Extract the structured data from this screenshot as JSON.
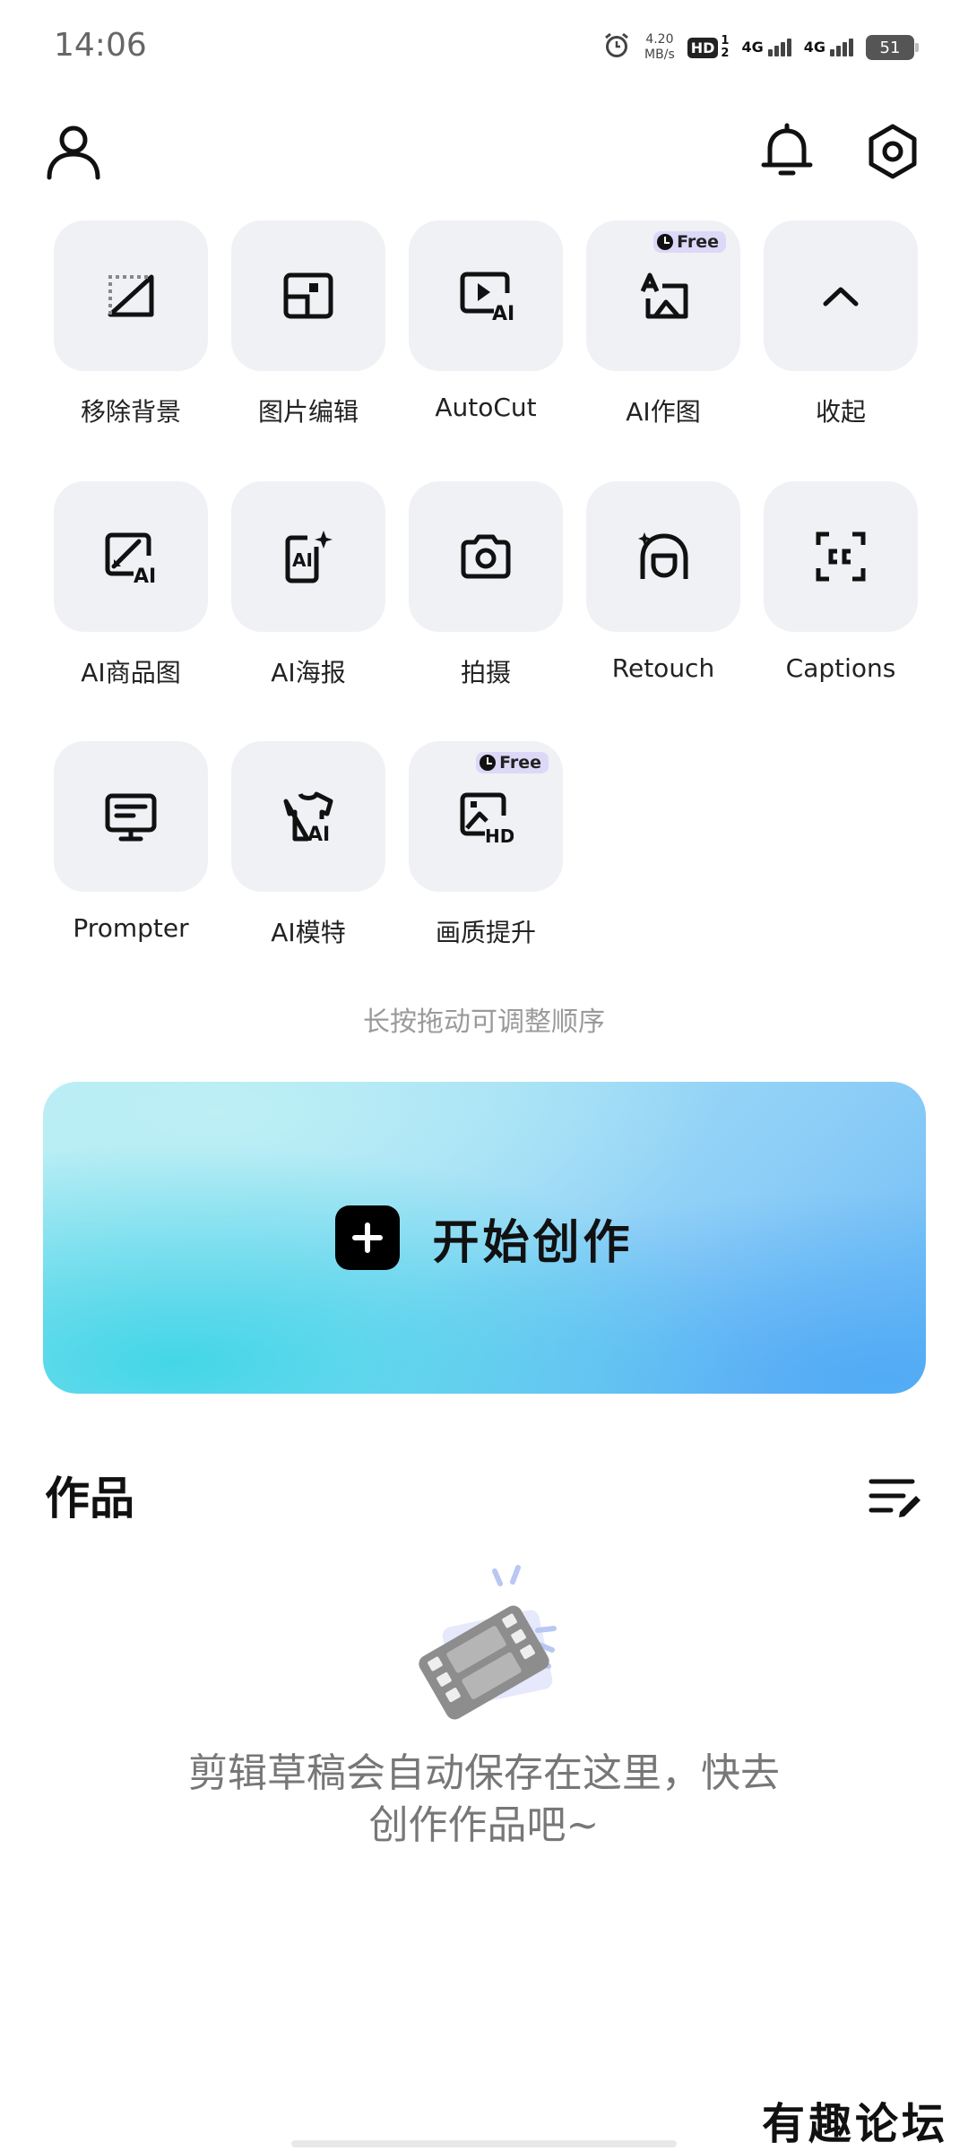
{
  "status_bar": {
    "time": "14:06",
    "speed_value": "4.20",
    "speed_unit": "MB/s",
    "hd_label": "HD",
    "sim_top": "1",
    "sim_bottom": "2",
    "net1": "4G",
    "net2": "4G",
    "battery": "51"
  },
  "header": {
    "profile_icon": "user-icon",
    "notification_icon": "bell-icon",
    "settings_icon": "gear-icon"
  },
  "tools": [
    {
      "label": "移除背景",
      "icon": "remove-background-icon"
    },
    {
      "label": "图片编辑",
      "icon": "image-edit-icon"
    },
    {
      "label": "AutoCut",
      "icon": "autocut-icon"
    },
    {
      "label": "AI作图",
      "icon": "ai-drawing-icon",
      "badge": "Free"
    },
    {
      "label": "收起",
      "icon": "chevron-up-icon"
    },
    {
      "label": "AI商品图",
      "icon": "ai-product-image-icon"
    },
    {
      "label": "AI海报",
      "icon": "ai-poster-icon"
    },
    {
      "label": "拍摄",
      "icon": "camera-icon"
    },
    {
      "label": "Retouch",
      "icon": "retouch-icon"
    },
    {
      "label": "Captions",
      "icon": "captions-icon"
    },
    {
      "label": "Prompter",
      "icon": "prompter-icon"
    },
    {
      "label": "AI模特",
      "icon": "ai-model-icon"
    },
    {
      "label": "画质提升",
      "icon": "hd-enhance-icon",
      "badge": "Free"
    }
  ],
  "hint": "长按拖动可调整顺序",
  "create_button": {
    "label": "开始创作",
    "icon": "plus-icon"
  },
  "works": {
    "title": "作品",
    "sort_icon": "edit-list-icon",
    "empty_illustration_icon": "film-icon",
    "empty_line1": "剪辑草稿会自动保存在这里，快去",
    "empty_line2": "创作作品吧~"
  },
  "watermark": "有趣论坛",
  "colors": {
    "tile_bg": "#eff1f5",
    "badge_bg": "#ddd8f7",
    "banner_cyan": "#3ed6e6",
    "banner_blue": "#6bb9f5",
    "hint_text": "#9a9a9a",
    "empty_text": "#777777"
  }
}
